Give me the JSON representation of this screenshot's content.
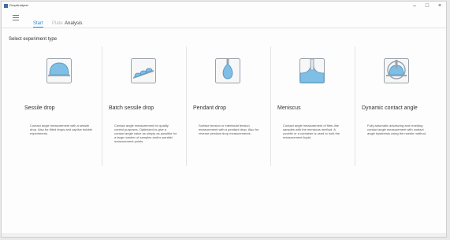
{
  "window": {
    "title": "DropAnalyzer"
  },
  "nav": {
    "tabs": [
      {
        "label": "Start",
        "active": true
      },
      {
        "label": "Plate",
        "active": false
      },
      {
        "label": "Analysis",
        "active": false
      }
    ]
  },
  "section_title": "Select experiment type",
  "cards": [
    {
      "title": "Sessile drop",
      "icon": "sessile-drop-icon",
      "desc": "Contact angle measurement with a sessile drop. Also for tilted drops and captive bubble experiments."
    },
    {
      "title": "Batch sessile drop",
      "icon": "batch-sessile-drop-icon",
      "desc": "Contact angle measurement for quality control purposes. Optimized to give a contact angle value as simply as possible for a large number of samples and/or parallel measurement points."
    },
    {
      "title": "Pendant drop",
      "icon": "pendant-drop-icon",
      "desc": "Surface tension or interfacial tension measurement with a pendant drop. Also for reverse pendant drop measurements."
    },
    {
      "title": "Meniscus",
      "icon": "meniscus-icon",
      "desc": "Contact angle measurement of fiber-like samples with the meniscus method. A cuvette or a container is used to hold the measurement liquid."
    },
    {
      "title": "Dynamic contact angle",
      "icon": "dynamic-contact-angle-icon",
      "desc": "Fully automatic advancing and receding contact angle measurement with contact angle hysteresis using the needle method."
    }
  ],
  "colors": {
    "accent": "#2f8fd0",
    "drop": "#7fbfe6"
  }
}
